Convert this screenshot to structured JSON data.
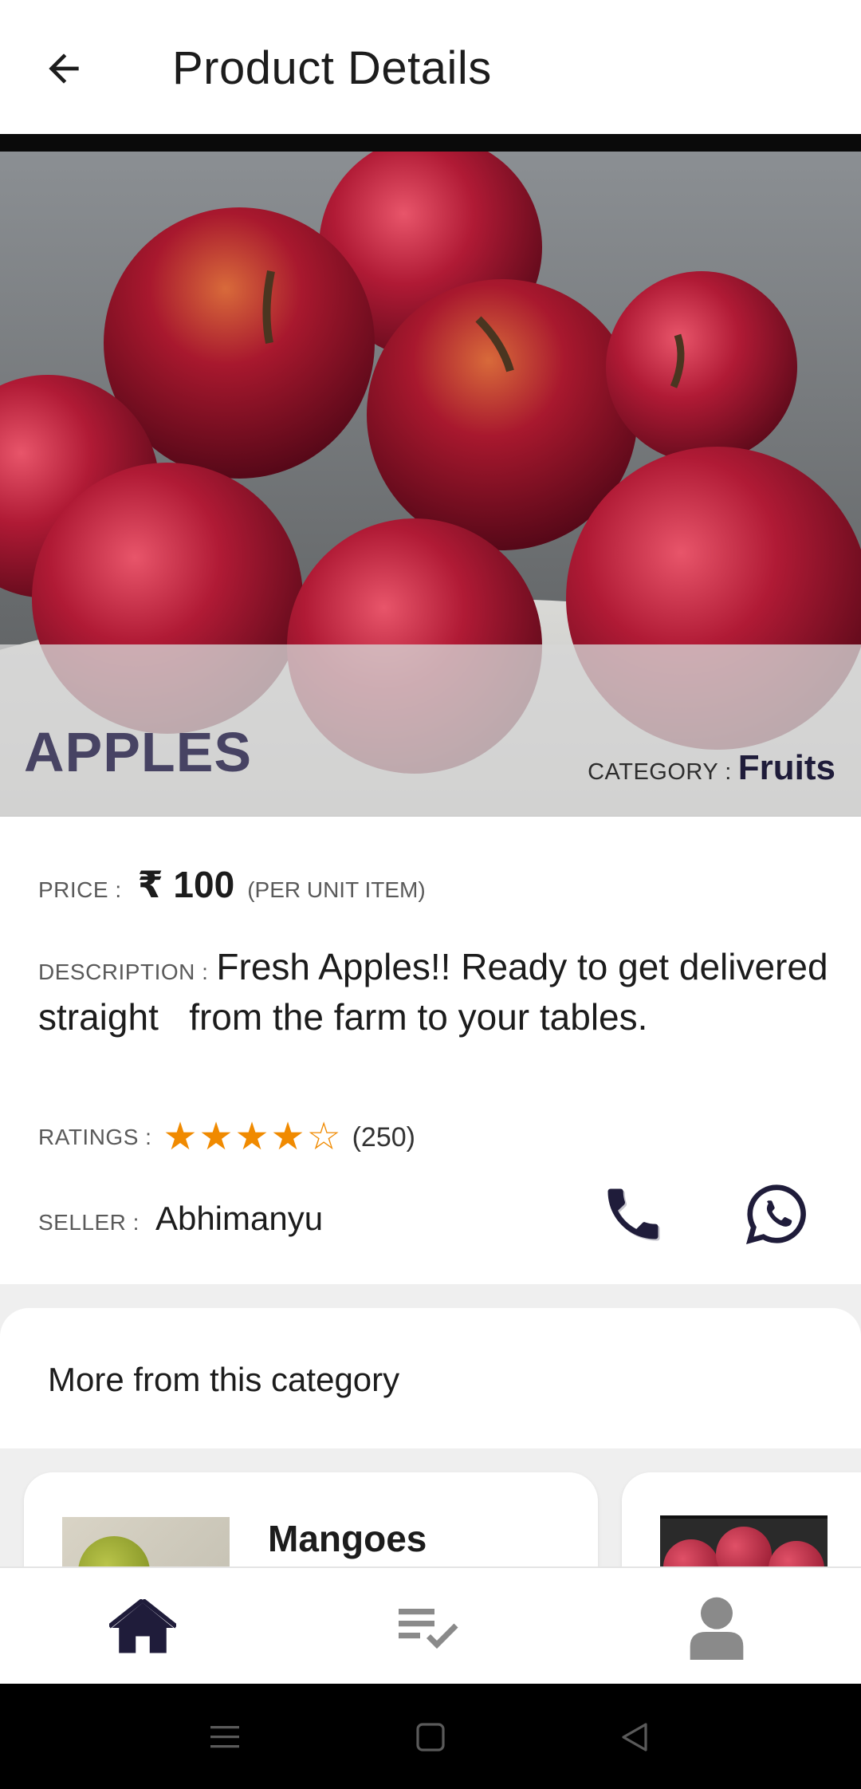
{
  "appbar": {
    "title": "Product Details",
    "back_icon": "arrow-left-icon"
  },
  "product": {
    "name": "APPLES",
    "category_label": "CATEGORY :",
    "category": "Fruits",
    "price_label": "PRICE :",
    "price": "₹ 100",
    "price_unit": "(PER UNIT ITEM)",
    "description_label": "DESCRIPTION :",
    "description": "Fresh Apples!! Ready to get delivered straight   from the farm to your tables.",
    "ratings_label": "RATINGS :",
    "rating_value": 4,
    "rating_max": 5,
    "rating_count": "(250)",
    "seller_label": "SELLER :",
    "seller": "Abhimanyu"
  },
  "contact": {
    "call_icon": "phone-icon",
    "whatsapp_icon": "whatsapp-icon"
  },
  "more": {
    "title": "More from this category",
    "items": [
      {
        "title": "Mangoes"
      },
      {
        "title": ""
      }
    ]
  },
  "bottom_nav": {
    "items": [
      {
        "icon": "home-icon",
        "active": true
      },
      {
        "icon": "orders-list-icon",
        "active": false
      },
      {
        "icon": "profile-icon",
        "active": false
      }
    ]
  },
  "colors": {
    "accent": "#1f1c3a",
    "star": "#f08a00",
    "inactive": "#8a8a8a"
  }
}
